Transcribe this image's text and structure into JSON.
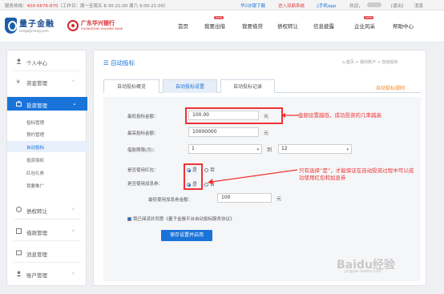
{
  "topbar": {
    "hotline_label": "服务热线：",
    "hotline_number": "400-6676-870",
    "hours": "（工作日：周一至周五 8:30-21:00 周六 9:00-21:00）",
    "download": "华兴E银下载",
    "gold_system": "进入双鼎系统",
    "mobile": "手机app",
    "welcome": "欢迎，",
    "logout": "[退出]",
    "messages": "消息"
  },
  "brand": {
    "name": "量子金融",
    "site": "liangzijinrong.com",
    "partner": "广东华兴银行",
    "partner_sub": "GUANGDONG HUAXING BANK"
  },
  "nav": {
    "items": [
      {
        "label": "首页"
      },
      {
        "label": "我要出借",
        "badge": "NEW"
      },
      {
        "label": "我要借贷"
      },
      {
        "label": "债权转让"
      },
      {
        "label": "信息披露"
      },
      {
        "label": "企业风采",
        "badge": "NEW"
      },
      {
        "label": "帮助中心"
      }
    ]
  },
  "sidebar": {
    "personal": "个人中心",
    "funds": "资金管理",
    "invest": "投资管理",
    "sub": [
      "投标管理",
      "预约管理",
      "自动投标",
      "投资授权",
      "红包礼券",
      "我要推广"
    ],
    "debt": "债权转让",
    "loan": "借款管理",
    "msg": "消息管理",
    "account": "账户管理"
  },
  "main": {
    "title": "自动投标",
    "breadcrumb": "首页 > 我的账户 > 自动投标",
    "tabs": [
      "自动投标概览",
      "自动投标设置",
      "自动投标记录"
    ],
    "rule_link": "自动投标规则",
    "form": {
      "min_label": "最低投标金额：",
      "min_value": "100.00",
      "max_label": "最高投标金额：",
      "max_value": "10000000",
      "unit": "元",
      "period_label": "借款期限(月)：",
      "period_from": "1",
      "to": "到",
      "period_to": "12",
      "redpack_label": "是否使用红包：",
      "coupon_label": "是否使用加息券：",
      "yes": "是",
      "no": "否",
      "coupon_min_label": "最低使用加息券金额：",
      "coupon_min_value": "100",
      "agree": "我已阅读并同意《量子金融平台自动投标服务协议》",
      "submit": "保存设置并启用"
    },
    "note1": "金额设置越低，成功投资的几率越高",
    "note2": "只有选择“是”，才能保证在自动投资过程中可以成功使用红包和加息券"
  },
  "watermark": {
    "text": "Baidu经验",
    "sub": "jingyan.baidu.com"
  },
  "colors": {
    "accent": "#1a73d9",
    "highlight": "#e33333",
    "orange": "#f08519"
  }
}
